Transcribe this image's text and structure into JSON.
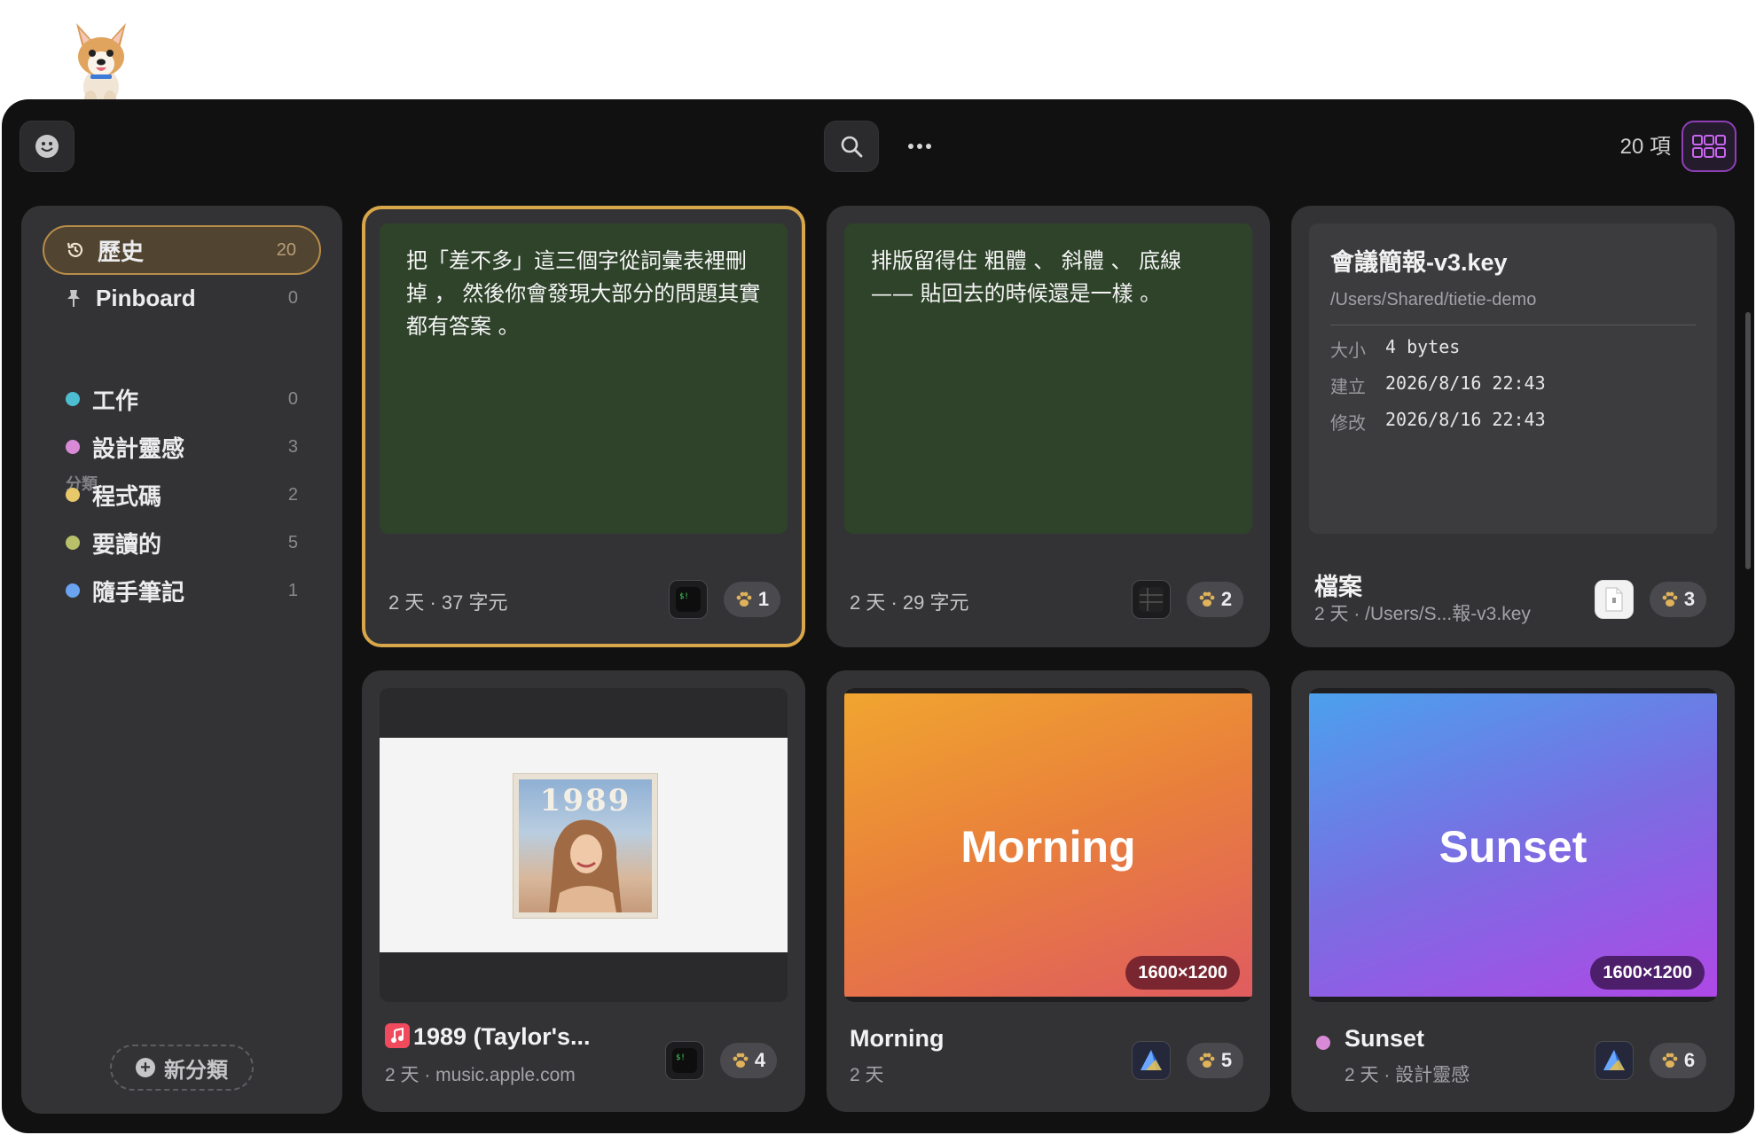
{
  "toolbar": {
    "icons": [
      "smiley-icon",
      "search-icon",
      "more-icon",
      "grid-icon"
    ],
    "item_count": "20 項"
  },
  "sidebar": {
    "history": {
      "label": "歷史",
      "count": "20",
      "icon": "history-icon"
    },
    "pinboard": {
      "label": "Pinboard",
      "count": "0",
      "icon": "pin-icon"
    },
    "section_title": "分類",
    "categories": [
      {
        "label": "工作",
        "count": "0",
        "color": "#4dbdd1"
      },
      {
        "label": "設計靈感",
        "count": "3",
        "color": "#d98ad6"
      },
      {
        "label": "程式碼",
        "count": "2",
        "color": "#e7c86a"
      },
      {
        "label": "要讀的",
        "count": "5",
        "color": "#b8c06a"
      },
      {
        "label": "隨手筆記",
        "count": "1",
        "color": "#6aa4f0"
      }
    ],
    "new_category": "新分類"
  },
  "cards": [
    {
      "text": "把「差不多」這三個字從詞彙表裡刪掉 ， 然後你會發現大部分的問題其實都有答案 。",
      "meta": "2 天 · 37 字元",
      "app_icon": "terminal-icon",
      "paw": "1"
    },
    {
      "text": "排版留得住 粗體 、 斜體 、 底線 —— 貼回去的時候還是一樣 。",
      "meta": "2 天 · 29 字元",
      "app_icon": "spreadsheet-icon",
      "paw": "2"
    },
    {
      "file_title": "會議簡報-v3.key",
      "file_path": "/Users/Shared/tietie-demo",
      "rows": [
        {
          "k": "大小",
          "v": "4 bytes"
        },
        {
          "k": "建立",
          "v": "2026/8/16 22:43"
        },
        {
          "k": "修改",
          "v": "2026/8/16 22:43"
        }
      ],
      "title": "檔案",
      "sub": "2 天 · /Users/S...報-v3.key",
      "app_icon": "document-icon",
      "paw": "3"
    },
    {
      "title": "1989 (Taylor's...",
      "sub": "2 天 · music.apple.com",
      "album_text": "1989",
      "app_icon": "terminal-icon",
      "paw": "4"
    },
    {
      "big": "Morning",
      "dim": "1600×1200",
      "title": "Morning",
      "sub": "2 天",
      "app_icon": "affinity-icon",
      "paw": "5"
    },
    {
      "big": "Sunset",
      "dim": "1600×1200",
      "title": "Sunset",
      "sub": "2 天 · 設計靈感",
      "dot_color": "#d98ad6",
      "app_icon": "affinity-icon",
      "paw": "6"
    }
  ]
}
